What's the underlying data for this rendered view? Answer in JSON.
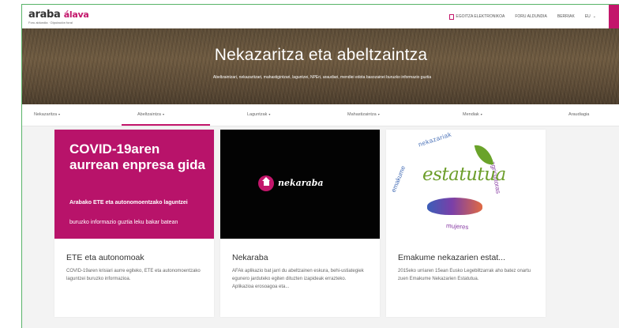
{
  "header": {
    "logo_main": "araba",
    "logo_accent": "álava",
    "logo_sub": "Foru aldundia · Diputación foral",
    "links": [
      "EGOITZA ELEKTRONIKOA",
      "FORU ALDUNDIA",
      "BERRIAK"
    ],
    "lang": "EU",
    "icons": [
      "document-icon",
      "chevron-down-icon"
    ]
  },
  "hero": {
    "title": "Nekazaritza eta abeltzaintza",
    "description": "Abeltzaintzari, nekazaritzari, mahastigintzari, laguntzei, NPEri, araudiari, mendiei edota basozainei buruzko informazio guztia"
  },
  "categories": [
    {
      "label": "Nekazaritza"
    },
    {
      "label": "Abeltzaintza"
    },
    {
      "label": "Laguntzak"
    },
    {
      "label": "Mahastizaintza"
    },
    {
      "label": "Mendiak"
    },
    {
      "label": "Araudiagia"
    }
  ],
  "cards": [
    {
      "title": "ETE eta autonomoak",
      "text": "COVID-19aren krisiari aurre egiteko, ETE eta autonomoentzako laguntzei buruzko informazioa.",
      "image": {
        "headline": "COVID-19aren aurrean enpresa gida",
        "bold_line": "Arabako ETE eta autonomoentzako laguntzei",
        "normal_line": "buruzko informazio guztia leku bakar batean"
      }
    },
    {
      "title": "Nekaraba",
      "text": "AFAk aplikazio bat jarri du abeltzainen eskura, behi-ustiategiek egunero jarduteko egiten dituzten izapideak errazteko. Aplikazioa erosoagoa eta...",
      "image": {
        "logo_text": "nekaraba"
      }
    },
    {
      "title": "Emakume nekazarien estat...",
      "text": "2015eko urriaren 15ean Eusko Legebiltzarrak aho batez onartu zuen Emakume Nekazarien Estatutua.",
      "image": {
        "logo_word": "estatutua",
        "arc_top": "nekazariak",
        "arc_left": "emakume",
        "arc_right": "agricultoras",
        "arc_bottom": "mujeres"
      }
    }
  ],
  "colors": {
    "accent": "#c3166b",
    "frame": "#58b368",
    "estatutua_green": "#6d9e2b"
  }
}
